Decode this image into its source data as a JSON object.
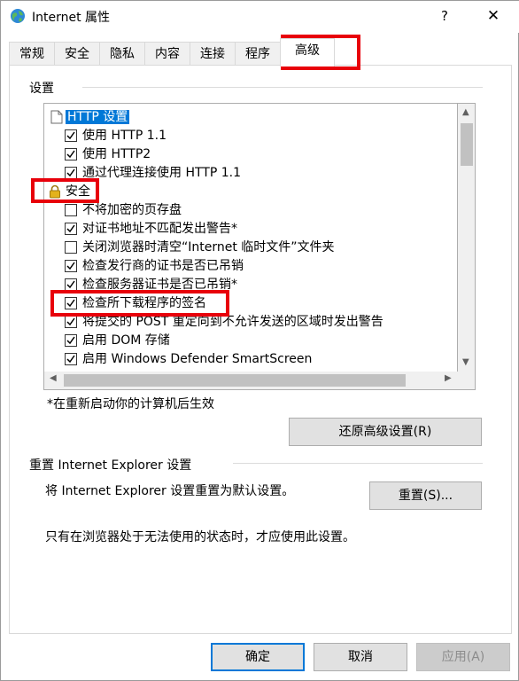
{
  "window": {
    "title": "Internet 属性",
    "help_glyph": "?",
    "close_glyph": "✕"
  },
  "tabs": [
    {
      "label": "常规"
    },
    {
      "label": "安全"
    },
    {
      "label": "隐私"
    },
    {
      "label": "内容"
    },
    {
      "label": "连接"
    },
    {
      "label": "程序"
    },
    {
      "label": "高级",
      "active": true
    }
  ],
  "settings": {
    "group_label": "设置",
    "items": [
      {
        "type": "category",
        "icon": "page-icon",
        "label": "HTTP 设置",
        "selected": true
      },
      {
        "type": "checkbox",
        "label": "使用 HTTP 1.1",
        "checked": true
      },
      {
        "type": "checkbox",
        "label": "使用 HTTP2",
        "checked": true
      },
      {
        "type": "checkbox",
        "label": "通过代理连接使用 HTTP 1.1",
        "checked": true
      },
      {
        "type": "category",
        "icon": "lock-icon",
        "label": "安全"
      },
      {
        "type": "checkbox",
        "label": "不将加密的页存盘",
        "checked": false
      },
      {
        "type": "checkbox",
        "label": "对证书地址不匹配发出警告*",
        "checked": true
      },
      {
        "type": "checkbox",
        "label": "关闭浏览器时清空“Internet 临时文件”文件夹",
        "checked": false
      },
      {
        "type": "checkbox",
        "label": "检查发行商的证书是否已吊销",
        "checked": true
      },
      {
        "type": "checkbox",
        "label": "检查服务器证书是否已吊销*",
        "checked": true
      },
      {
        "type": "checkbox",
        "label": "检查所下载程序的签名",
        "checked": true
      },
      {
        "type": "checkbox",
        "label": "将提交的 POST 重定向到不允许发送的区域时发出警告",
        "checked": true
      },
      {
        "type": "checkbox",
        "label": "启用 DOM 存储",
        "checked": true
      },
      {
        "type": "checkbox",
        "label": "启用 Windows Defender SmartScreen",
        "checked": true
      }
    ],
    "note": "*在重新启动你的计算机后生效",
    "restore_button": "还原高级设置(R)"
  },
  "reset": {
    "group_label": "重置 Internet Explorer 设置",
    "description": "将 Internet Explorer 设置重置为默认设置。",
    "button": "重置(S)...",
    "warning": "只有在浏览器处于无法使用的状态时，才应使用此设置。"
  },
  "footer": {
    "ok": "确定",
    "cancel": "取消",
    "apply": "应用(A)"
  },
  "colors": {
    "annotation": "#e8000b",
    "selection": "#0078d7"
  }
}
